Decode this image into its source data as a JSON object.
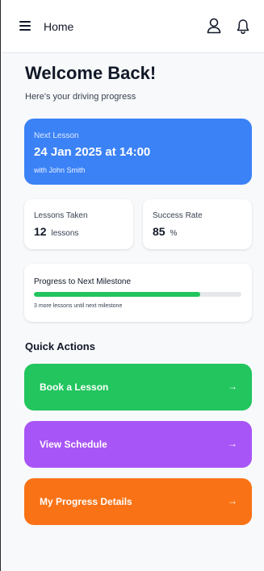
{
  "header": {
    "title": "Home",
    "menu_icon": "hamburger-menu-icon",
    "user_icon": "user-icon",
    "bell_icon": "bell-icon"
  },
  "welcome": {
    "title": "Welcome Back!",
    "subtitle": "Here's your driving progress"
  },
  "next_lesson": {
    "label": "Next Lesson",
    "datetime": "24 Jan 2025 at 14:00",
    "instructor": "with John Smith",
    "color": "#3b82f6"
  },
  "stats": {
    "lessons_taken": {
      "label": "Lessons Taken",
      "value": "12",
      "unit": "lessons"
    },
    "success_rate": {
      "label": "Success Rate",
      "value": "85",
      "unit": "%"
    }
  },
  "milestone": {
    "label": "Progress to Next Milestone",
    "progress_fraction": 0.8,
    "note": "3 more lessons until next milestone",
    "fill_color": "#22c55e"
  },
  "quick_actions": {
    "title": "Quick Actions",
    "items": [
      {
        "label": "Book a Lesson",
        "arrow": "→",
        "color": "#22c55e"
      },
      {
        "label": "View Schedule",
        "arrow": "→",
        "color": "#a855f7"
      },
      {
        "label": "My Progress Details",
        "arrow": "→",
        "color": "#f97316"
      }
    ]
  }
}
